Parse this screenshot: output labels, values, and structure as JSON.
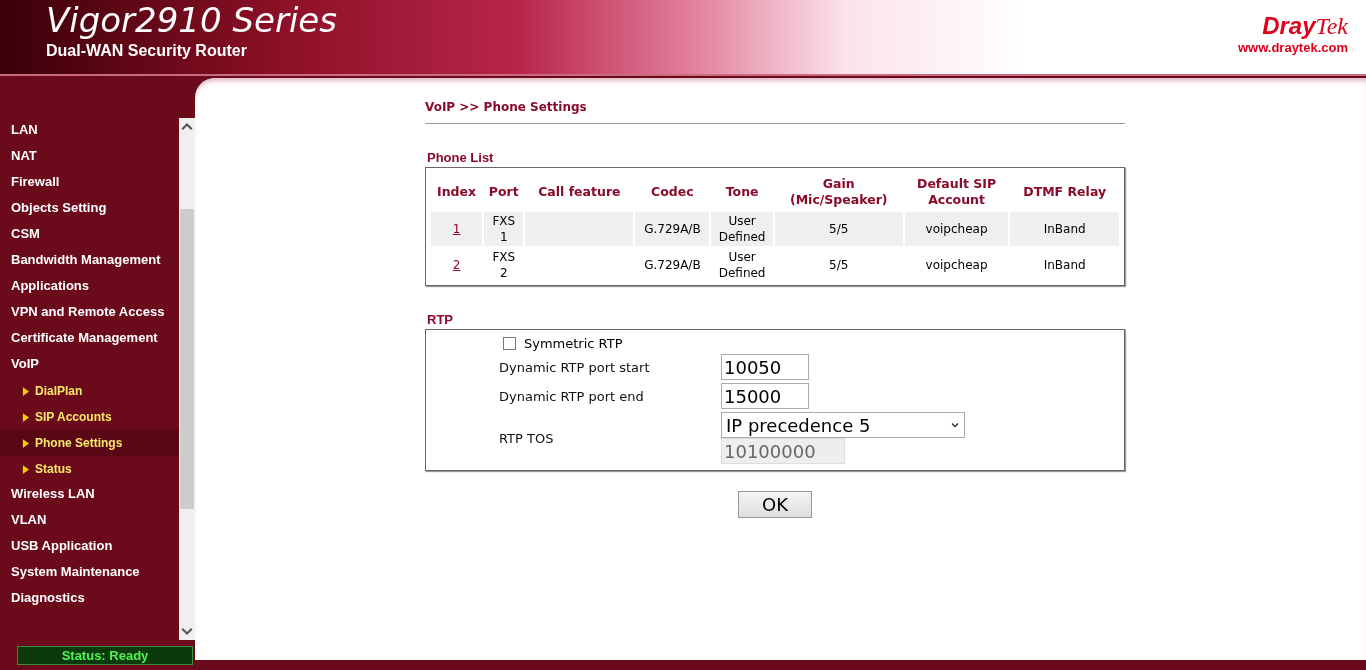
{
  "header": {
    "title": "Vigor2910 Series",
    "subtitle": "Dual-WAN Security Router",
    "logo_brand": "Dray",
    "logo_brand_2": "Tek",
    "logo_url": "www.draytek.com"
  },
  "sidebar": {
    "items": [
      {
        "label": "LAN",
        "selected": false
      },
      {
        "label": "NAT",
        "selected": false
      },
      {
        "label": "Firewall",
        "selected": false
      },
      {
        "label": "Objects Setting",
        "selected": false
      },
      {
        "label": "CSM",
        "selected": false
      },
      {
        "label": "Bandwidth Management",
        "selected": false
      },
      {
        "label": "Applications",
        "selected": false
      },
      {
        "label": "VPN and Remote Access",
        "selected": false
      },
      {
        "label": "Certificate Management",
        "selected": false
      },
      {
        "label": "VoIP",
        "selected": false,
        "children": [
          {
            "label": "DialPlan",
            "selected": false
          },
          {
            "label": "SIP Accounts",
            "selected": false
          },
          {
            "label": "Phone Settings",
            "selected": true
          },
          {
            "label": "Status",
            "selected": false
          }
        ]
      },
      {
        "label": "Wireless LAN",
        "selected": false
      },
      {
        "label": "VLAN",
        "selected": false
      },
      {
        "label": "USB Application",
        "selected": false
      },
      {
        "label": "System Maintenance",
        "selected": false
      },
      {
        "label": "Diagnostics",
        "selected": false
      }
    ],
    "status": "Status: Ready"
  },
  "breadcrumb": "VoIP >> Phone Settings",
  "phone_list": {
    "title": "Phone List",
    "columns": [
      "Index",
      "Port",
      "Call feature",
      "Codec",
      "Tone",
      "Gain\n(Mic/Speaker)",
      "Default SIP\nAccount",
      "DTMF Relay"
    ],
    "rows": [
      [
        "1",
        "FXS\n1",
        "",
        "G.729A/B",
        "User\nDefined",
        "5/5",
        "voipcheap",
        "InBand"
      ],
      [
        "2",
        "FXS\n2",
        "",
        "G.729A/B",
        "User\nDefined",
        "5/5",
        "voipcheap",
        "InBand"
      ]
    ]
  },
  "rtp": {
    "title": "RTP",
    "symmetric": {
      "label": "Symmetric RTP",
      "checked": false
    },
    "fields": [
      {
        "label": "Dynamic RTP port start",
        "value": "10050"
      },
      {
        "label": "Dynamic RTP port end",
        "value": "15000"
      }
    ],
    "tos": {
      "label": "RTP TOS",
      "selected_option": "IP precedence 5",
      "value": "10100000",
      "disabled": true
    }
  },
  "buttons": [
    "OK"
  ]
}
